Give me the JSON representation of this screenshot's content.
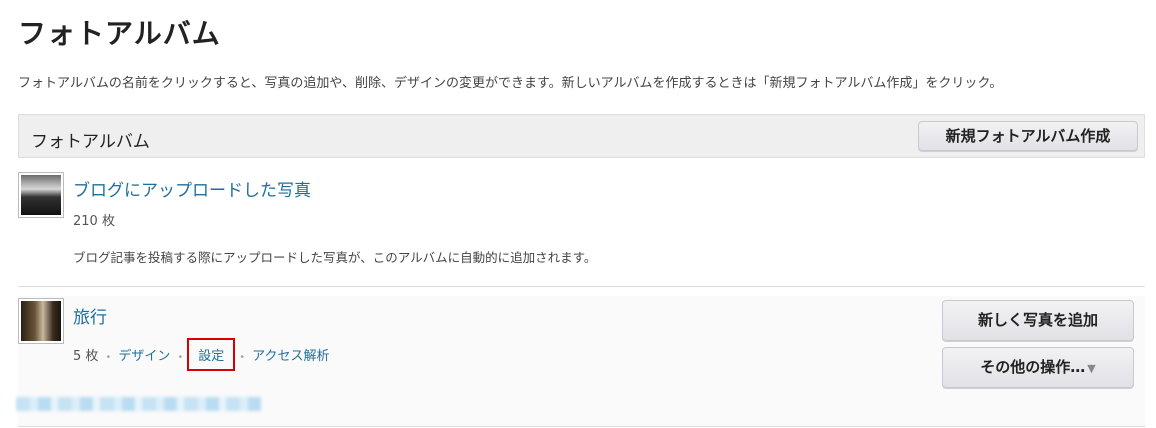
{
  "page": {
    "title": "フォトアルバム",
    "intro": "フォトアルバムの名前をクリックすると、写真の追加や、削除、デザインの変更ができます。新しいアルバムを作成するときは「新規フォトアルバム作成」をクリック。"
  },
  "section": {
    "title": "フォトアルバム",
    "new_button": "新規フォトアルバム作成"
  },
  "albums": [
    {
      "name": "ブログにアップロードした写真",
      "count": "210 枚",
      "description": "ブログ記事を投稿する際にアップロードした写真が、このアルバムに自動的に追加されます。"
    },
    {
      "name": "旅行",
      "count": "5 枚",
      "links": {
        "design": "デザイン",
        "settings": "設定",
        "access": "アクセス解析"
      },
      "add_button": "新しく写真を追加",
      "more_button": "その他の操作…"
    }
  ],
  "colors": {
    "link": "#1f6f9a",
    "highlight_border": "#d60000",
    "header_bg": "#efefef"
  }
}
